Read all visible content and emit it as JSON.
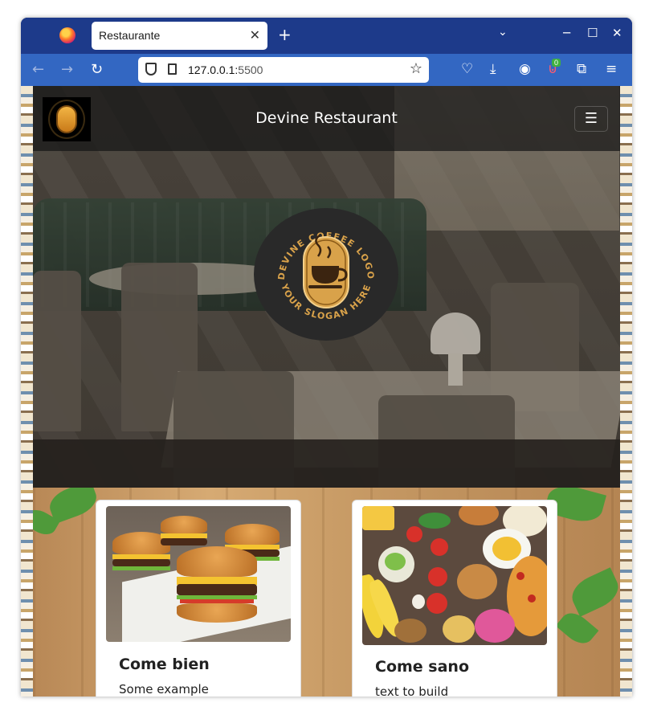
{
  "browser": {
    "tab_title": "Restaurante",
    "tab_close": "✕",
    "new_tab": "+",
    "window_controls": {
      "minimize": "─",
      "maximize": "☐",
      "close": "✕"
    },
    "nav": {
      "back": "←",
      "forward": "→",
      "reload": "↻"
    },
    "url_host": "127.0.0.1:",
    "url_port": "5500",
    "bookmark_star": "☆",
    "toolbar_icons": [
      "pocket-icon",
      "download-icon",
      "account-icon",
      "extension-badge-icon",
      "extensions-icon",
      "menu-icon"
    ],
    "extension_badge": "0",
    "menu_glyph": "≡"
  },
  "site": {
    "brand_title": "Devine Restaurant",
    "hamburger": "☰",
    "emblem": {
      "top_text": "DEVINE COFFEE LOGO",
      "bottom_text": "YOUR SLOGAN HERE"
    }
  },
  "cards": [
    {
      "title": "Come bien",
      "text": "Some example"
    },
    {
      "title": "Come sano",
      "text": "text to build"
    }
  ],
  "colors": {
    "tabbar": "#1d3a8a",
    "toolbar": "#3367c2",
    "navbar": "#161616",
    "emblem_gold": "#d9a24a"
  }
}
